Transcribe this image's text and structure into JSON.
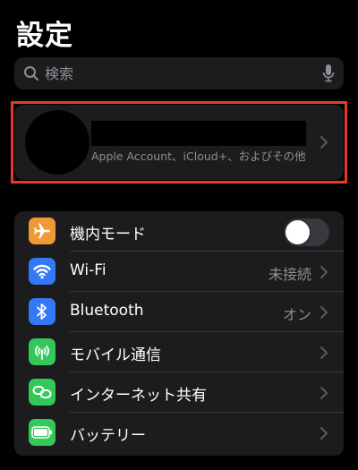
{
  "header": {
    "title": "設定"
  },
  "search": {
    "placeholder": "検索",
    "icon": "magnifying-glass-icon",
    "mic_icon": "microphone-icon"
  },
  "account": {
    "subtitle": "Apple Account、iCloud+、およびその他"
  },
  "colors": {
    "highlight_border": "#e83828",
    "airplane": "#f09a37",
    "wifi": "#3478f6",
    "bluetooth": "#3478f6",
    "cellular": "#34c759",
    "hotspot": "#34c759",
    "battery": "#34c759"
  },
  "settings": {
    "items": [
      {
        "label": "機内モード",
        "icon": "airplane-icon",
        "control": "toggle",
        "toggle_on": false
      },
      {
        "label": "Wi-Fi",
        "icon": "wifi-icon",
        "value": "未接続"
      },
      {
        "label": "Bluetooth",
        "icon": "bluetooth-icon",
        "value": "オン"
      },
      {
        "label": "モバイル通信",
        "icon": "cellular-icon"
      },
      {
        "label": "インターネット共有",
        "icon": "hotspot-icon"
      },
      {
        "label": "バッテリー",
        "icon": "battery-icon"
      }
    ]
  }
}
